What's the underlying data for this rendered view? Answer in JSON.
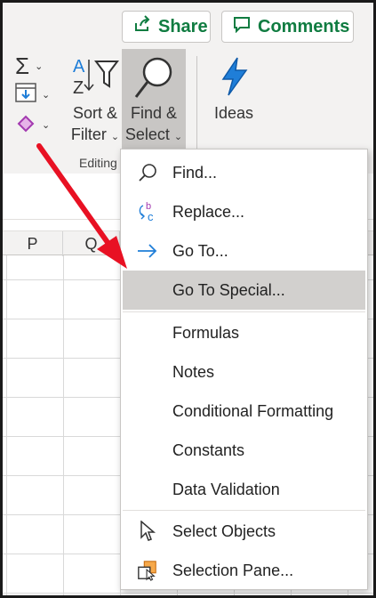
{
  "header": {
    "share_label": "Share",
    "comments_label": "Comments"
  },
  "ribbon": {
    "sort_filter_line1": "Sort &",
    "sort_filter_line2": "Filter",
    "find_select_line1": "Find &",
    "find_select_line2": "Select",
    "ideas_label": "Ideas",
    "group_label": "Editing"
  },
  "columns": [
    "P",
    "Q"
  ],
  "menu": {
    "items": [
      {
        "label": "Find...",
        "icon": "magnifier-icon"
      },
      {
        "label": "Replace...",
        "icon": "replace-icon"
      },
      {
        "label": "Go To...",
        "icon": "arrow-right-icon"
      },
      {
        "label": "Go To Special...",
        "icon": ""
      },
      {
        "label": "Formulas",
        "icon": ""
      },
      {
        "label": "Notes",
        "icon": ""
      },
      {
        "label": "Conditional Formatting",
        "icon": ""
      },
      {
        "label": "Constants",
        "icon": ""
      },
      {
        "label": "Data Validation",
        "icon": ""
      },
      {
        "label": "Select Objects",
        "icon": "cursor-icon"
      },
      {
        "label": "Selection Pane...",
        "icon": "selection-pane-icon"
      }
    ]
  },
  "colors": {
    "accent_green": "#107c41",
    "highlight": "#d2d0ce",
    "arrow_red": "#e81123",
    "ideas_blue": "#1f7ed8"
  }
}
